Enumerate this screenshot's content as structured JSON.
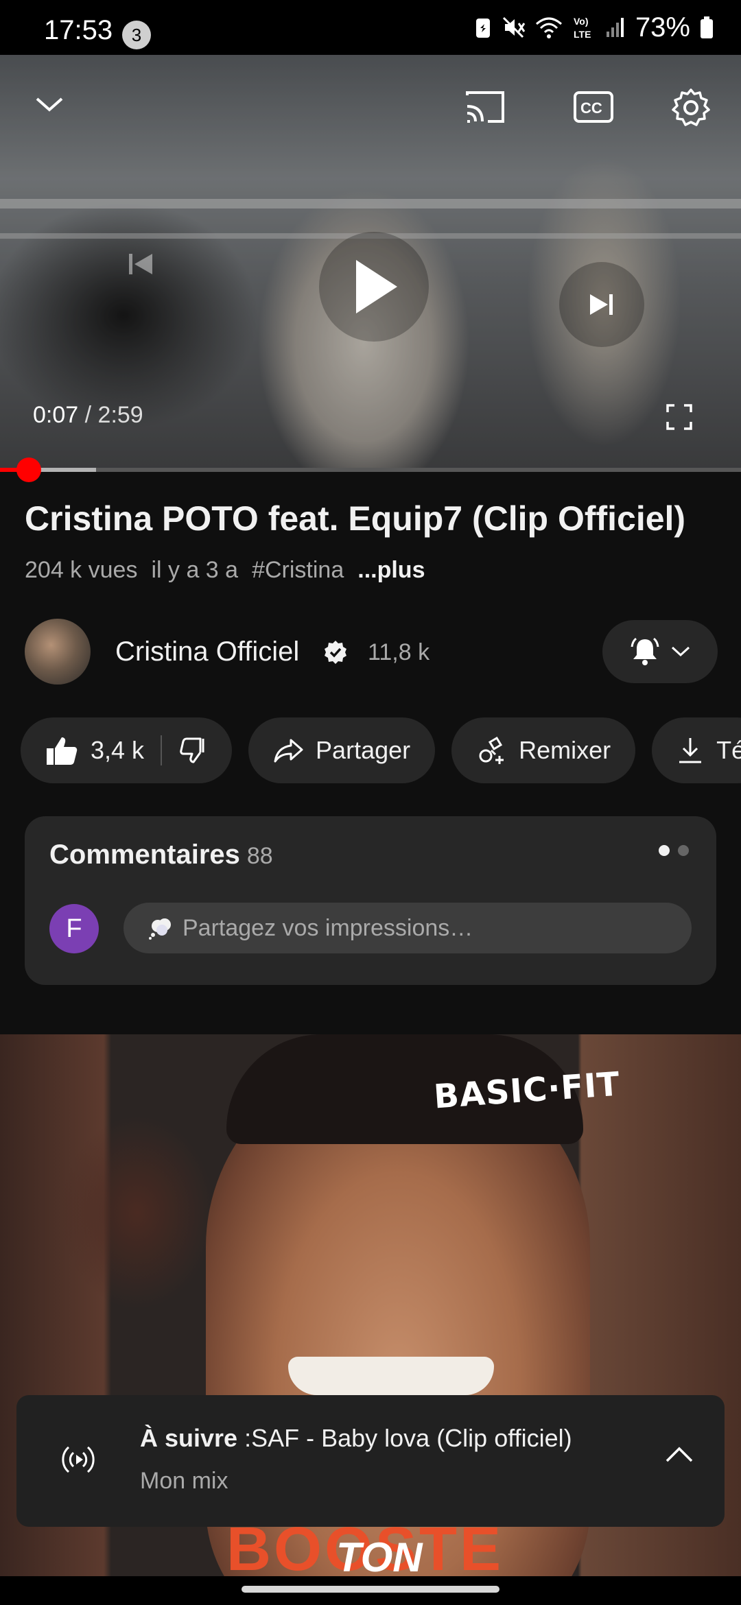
{
  "status_bar": {
    "time": "17:53",
    "notification_count": "3",
    "battery": "73%"
  },
  "player": {
    "current_time": "0:07",
    "separator": " / ",
    "duration": "2:59",
    "progress_fraction": 0.039
  },
  "video": {
    "title": "Cristina POTO feat. Equip7 (Clip Officiel)",
    "views": "204 k vues",
    "age": "il y a 3 a",
    "hashtag": "#Cristina",
    "more_label": "...plus"
  },
  "channel": {
    "name": "Cristina Officiel",
    "subscribers": "11,8 k"
  },
  "actions": {
    "likes": "3,4 k",
    "share": "Partager",
    "remix": "Remixer",
    "download": "Té"
  },
  "comments": {
    "title": "Commentaires",
    "count": "88",
    "user_initial": "F",
    "placeholder": "Partagez vos impressions…"
  },
  "ad": {
    "logo": "BASIC·FIT",
    "bottom_text": "BOOSTE",
    "overlay_text": "TON"
  },
  "up_next": {
    "prefix": "À suivre",
    "title": " :SAF - Baby lova (Clip officiel)",
    "subtitle": "Mon mix"
  },
  "colors": {
    "background": "#0f0f0f",
    "progress": "#ff0000",
    "pill": "#272727",
    "comment_avatar": "#7b3fb3"
  }
}
